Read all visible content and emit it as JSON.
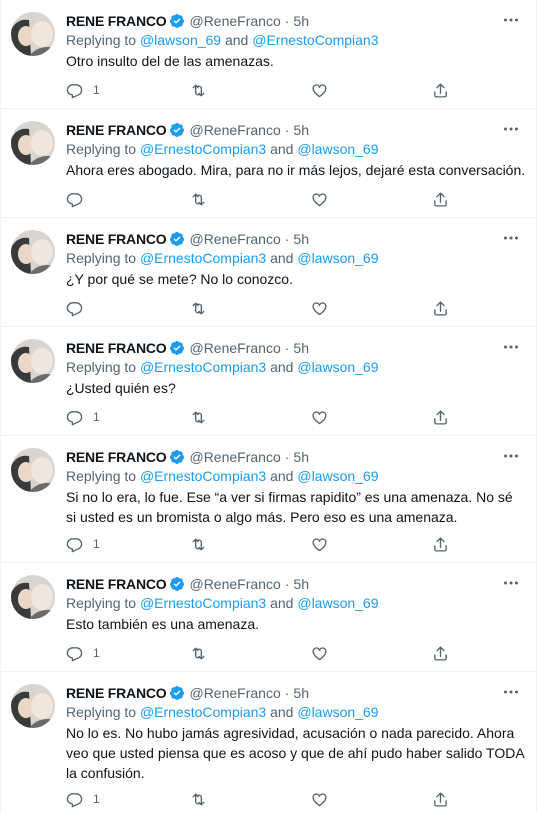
{
  "tweets": [
    {
      "name": "RENE FRANCO",
      "handle": "@ReneFranco",
      "sep": "·",
      "time": "5h",
      "replying_prefix": "Replying to ",
      "mention1": "@lawson_69",
      "conj": " and ",
      "mention2": "@ErnestoCompian3",
      "text": "Otro insulto del de las amenazas.",
      "reply_count": "1"
    },
    {
      "name": "RENE FRANCO",
      "handle": "@ReneFranco",
      "sep": "·",
      "time": "5h",
      "replying_prefix": "Replying to ",
      "mention1": "@ErnestoCompian3",
      "conj": " and ",
      "mention2": "@lawson_69",
      "text": "Ahora eres abogado. Mira, para no ir más lejos, dejaré esta conversación.",
      "reply_count": ""
    },
    {
      "name": "RENE FRANCO",
      "handle": "@ReneFranco",
      "sep": "·",
      "time": "5h",
      "replying_prefix": "Replying to ",
      "mention1": "@ErnestoCompian3",
      "conj": " and ",
      "mention2": "@lawson_69",
      "text": "¿Y por qué se mete? No lo conozco.",
      "reply_count": ""
    },
    {
      "name": "RENE FRANCO",
      "handle": "@ReneFranco",
      "sep": "·",
      "time": "5h",
      "replying_prefix": "Replying to ",
      "mention1": "@ErnestoCompian3",
      "conj": " and ",
      "mention2": "@lawson_69",
      "text": "¿Usted quién es?",
      "reply_count": "1"
    },
    {
      "name": "RENE FRANCO",
      "handle": "@ReneFranco",
      "sep": "·",
      "time": "5h",
      "replying_prefix": "Replying to ",
      "mention1": "@ErnestoCompian3",
      "conj": " and ",
      "mention2": "@lawson_69",
      "text": "Si no lo era, lo fue. Ese “a ver si firmas rapidito” es una amenaza. No sé si usted es un bromista o algo más. Pero eso es una amenaza.",
      "reply_count": "1"
    },
    {
      "name": "RENE FRANCO",
      "handle": "@ReneFranco",
      "sep": "·",
      "time": "5h",
      "replying_prefix": "Replying to ",
      "mention1": "@ErnestoCompian3",
      "conj": " and ",
      "mention2": "@lawson_69",
      "text": "Esto también es una amenaza.",
      "reply_count": "1"
    },
    {
      "name": "RENE FRANCO",
      "handle": "@ReneFranco",
      "sep": "·",
      "time": "5h",
      "replying_prefix": "Replying to ",
      "mention1": "@ErnestoCompian3",
      "conj": " and ",
      "mention2": "@lawson_69",
      "text": "No lo es. No hubo jamás agresividad, acusación o nada parecido. Ahora veo que usted piensa que es acoso y que de ahí pudo haber salido TODA la confusión.",
      "reply_count": "1"
    }
  ],
  "icons": {
    "verified": "verified-badge-icon",
    "more": "more-options-icon",
    "reply": "reply-icon",
    "retweet": "retweet-icon",
    "like": "like-icon",
    "share": "share-icon"
  },
  "colors": {
    "accent": "#1d9bf0",
    "secondary_text": "#536471",
    "primary_text": "#0f1419",
    "divider": "#eff3f4"
  }
}
